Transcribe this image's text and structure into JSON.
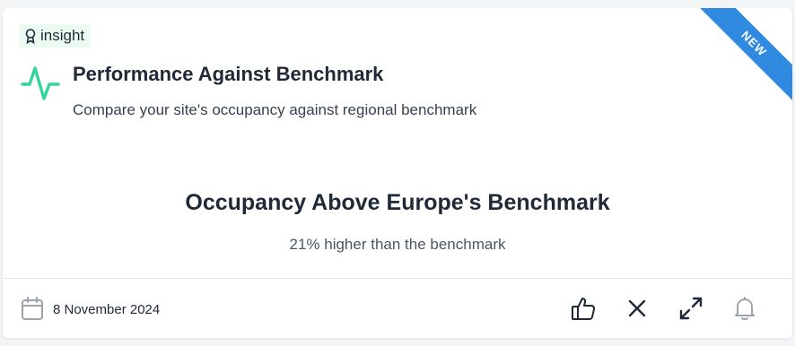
{
  "card": {
    "ribbon": "NEW",
    "tag": {
      "label": "insight",
      "icon": "award-icon"
    },
    "title": "Performance Against Benchmark",
    "subtitle": "Compare your site's occupancy against regional benchmark",
    "headline": "Occupancy Above Europe's Benchmark",
    "detail": "21% higher than the benchmark",
    "footer": {
      "date": "8 November 2024",
      "actions": [
        "thumbs-up-icon",
        "close-icon",
        "expand-icon",
        "bell-icon"
      ]
    }
  },
  "colors": {
    "accent": "#34d399",
    "ribbon": "#2f8ae0",
    "tag_bg": "#ecfbf2"
  }
}
